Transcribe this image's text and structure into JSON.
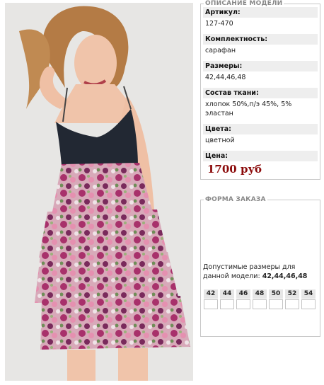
{
  "description": {
    "legend": "ОПИСАНИЕ МОДЕЛИ",
    "fields": [
      {
        "label": "Артикул:",
        "value": "127-470"
      },
      {
        "label": "Комплектность:",
        "value": "сарафан"
      },
      {
        "label": "Размеры:",
        "value": "42,44,46,48"
      },
      {
        "label": "Состав ткани:",
        "value": "хлопок 50%,п/э 45%, 5% эластан"
      },
      {
        "label": "Цвета:",
        "value": "цветной"
      }
    ],
    "price_label": "Цена:",
    "price": "1700 руб"
  },
  "order": {
    "legend": "ФОРМА ЗАКАЗА",
    "sizes_note": "Допустимые размеры для данной модели:",
    "sizes_value": "42,44,46,48",
    "sizes": [
      "42",
      "44",
      "46",
      "48",
      "50",
      "52",
      "54"
    ]
  },
  "colors": {
    "price": "#8b0a0a",
    "label_bg": "#eeeeee",
    "border": "#c8c8c8"
  }
}
